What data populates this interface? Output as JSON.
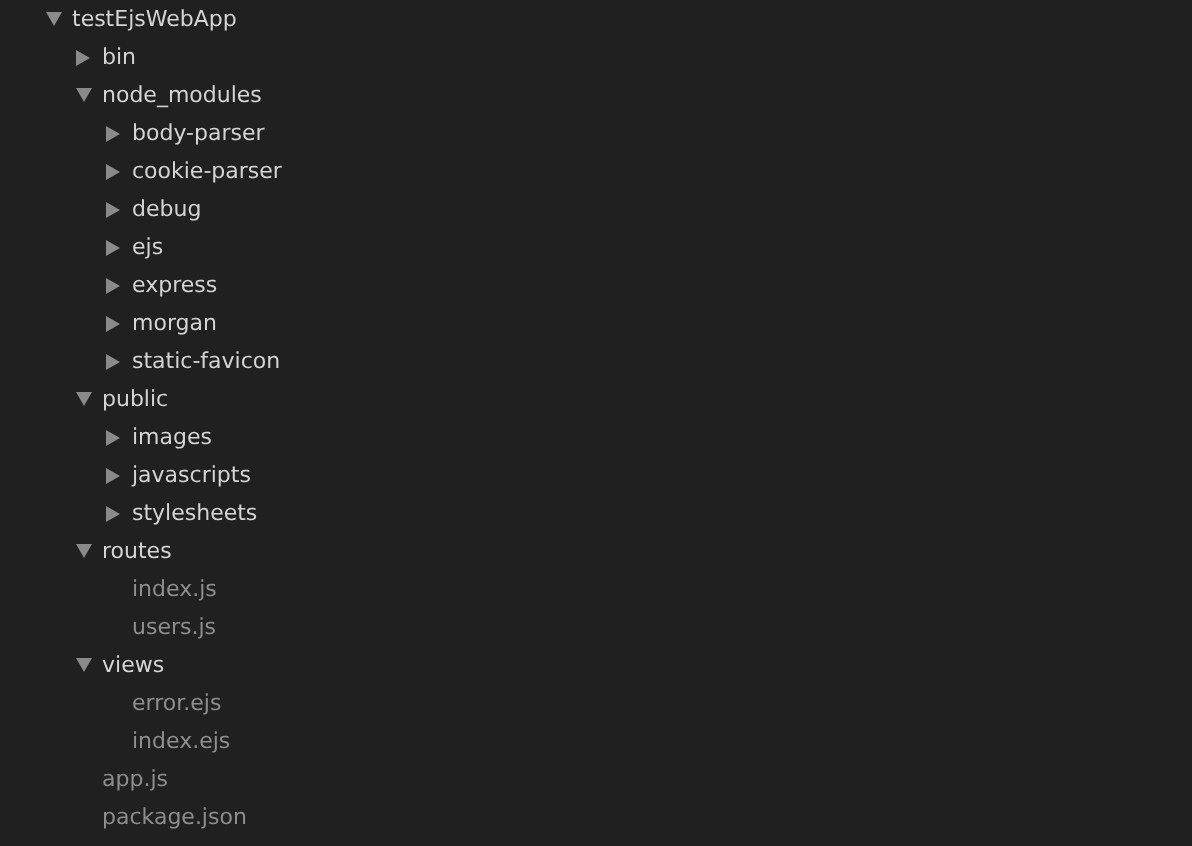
{
  "tree": [
    {
      "kind": "folder",
      "name": "testEjsWebApp",
      "expanded": true,
      "children": [
        {
          "kind": "folder",
          "name": "bin",
          "expanded": false
        },
        {
          "kind": "folder",
          "name": "node_modules",
          "expanded": true,
          "children": [
            {
              "kind": "folder",
              "name": "body-parser",
              "expanded": false
            },
            {
              "kind": "folder",
              "name": "cookie-parser",
              "expanded": false
            },
            {
              "kind": "folder",
              "name": "debug",
              "expanded": false
            },
            {
              "kind": "folder",
              "name": "ejs",
              "expanded": false
            },
            {
              "kind": "folder",
              "name": "express",
              "expanded": false
            },
            {
              "kind": "folder",
              "name": "morgan",
              "expanded": false
            },
            {
              "kind": "folder",
              "name": "static-favicon",
              "expanded": false
            }
          ]
        },
        {
          "kind": "folder",
          "name": "public",
          "expanded": true,
          "children": [
            {
              "kind": "folder",
              "name": "images",
              "expanded": false
            },
            {
              "kind": "folder",
              "name": "javascripts",
              "expanded": false
            },
            {
              "kind": "folder",
              "name": "stylesheets",
              "expanded": false
            }
          ]
        },
        {
          "kind": "folder",
          "name": "routes",
          "expanded": true,
          "children": [
            {
              "kind": "file",
              "name": "index.js"
            },
            {
              "kind": "file",
              "name": "users.js"
            }
          ]
        },
        {
          "kind": "folder",
          "name": "views",
          "expanded": true,
          "children": [
            {
              "kind": "file",
              "name": "error.ejs"
            },
            {
              "kind": "file",
              "name": "index.ejs"
            }
          ]
        },
        {
          "kind": "file",
          "name": "app.js"
        },
        {
          "kind": "file",
          "name": "package.json"
        }
      ]
    }
  ]
}
